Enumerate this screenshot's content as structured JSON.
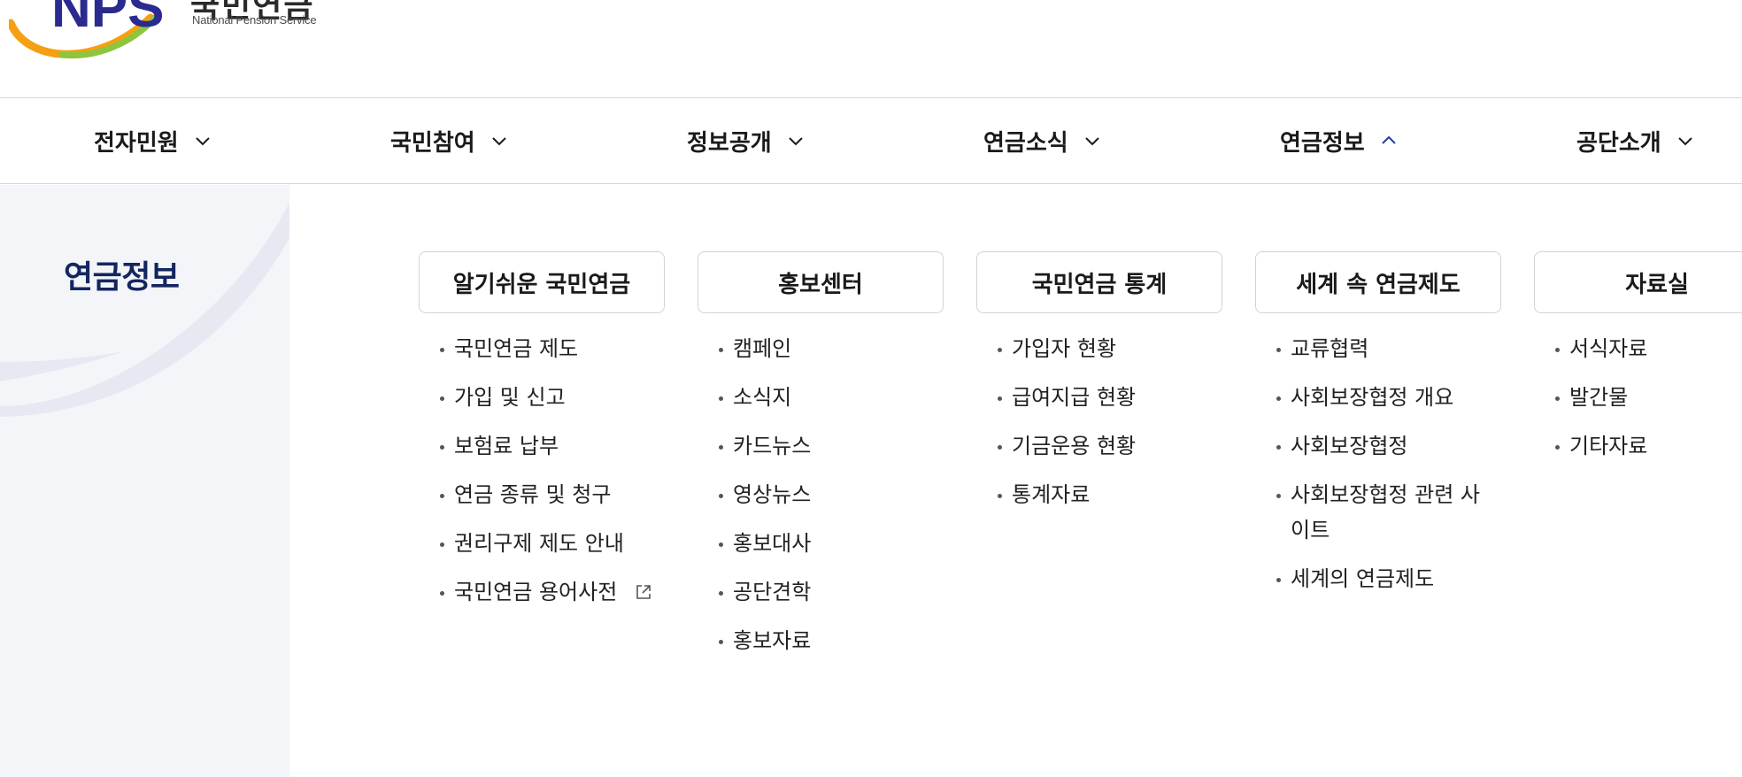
{
  "logo": {
    "letters": "NPS",
    "name_ko": "국민연금",
    "name_en": "National Pension Service",
    "colors": {
      "letters": "#2b2a8f",
      "orange": "#f5a012",
      "green": "#8cc63f"
    }
  },
  "nav": {
    "items": [
      {
        "label": "전자민원",
        "state": "collapsed"
      },
      {
        "label": "국민참여",
        "state": "collapsed"
      },
      {
        "label": "정보공개",
        "state": "collapsed"
      },
      {
        "label": "연금소식",
        "state": "collapsed"
      },
      {
        "label": "연금정보",
        "state": "expanded"
      },
      {
        "label": "공단소개",
        "state": "collapsed"
      }
    ],
    "active_color": "#1f3fa0"
  },
  "panel": {
    "title": "연금정보",
    "columns": [
      {
        "heading": "알기쉬운 국민연금",
        "links": [
          "국민연금 제도",
          "가입 및 신고",
          "보험료 납부",
          "연금 종류 및 청구",
          "권리구제 제도 안내",
          "국민연금 용어사전"
        ],
        "external_link_icon": "external-link-icon"
      },
      {
        "heading": "홍보센터",
        "links": [
          "캠페인",
          "소식지",
          "카드뉴스",
          "영상뉴스",
          "홍보대사",
          "공단견학",
          "홍보자료"
        ]
      },
      {
        "heading": "국민연금 통계",
        "links": [
          "가입자 현황",
          "급여지급 현황",
          "기금운용 현황",
          "통계자료"
        ]
      },
      {
        "heading": "세계 속 연금제도",
        "links": [
          "교류협력",
          "사회보장협정 개요",
          "사회보장협정",
          "사회보장협정 관련 사이트",
          "세계의 연금제도"
        ]
      },
      {
        "heading": "자료실",
        "links": [
          "서식자료",
          "발간물",
          "기타자료"
        ]
      }
    ]
  }
}
